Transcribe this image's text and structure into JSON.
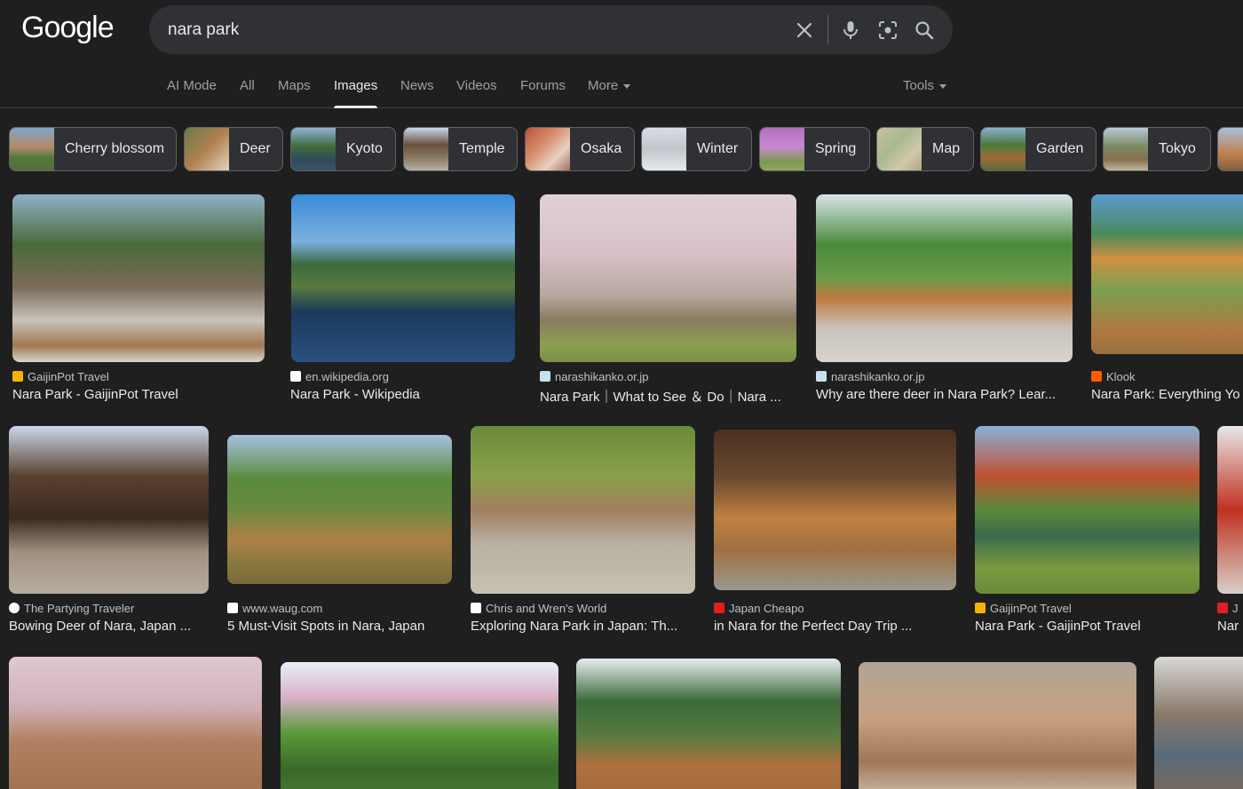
{
  "logo": "Google",
  "search": {
    "query": "nara park"
  },
  "tabs": [
    "AI Mode",
    "All",
    "Maps",
    "Images",
    "News",
    "Videos",
    "Forums",
    "More"
  ],
  "active_tab": "Images",
  "tools_label": "Tools",
  "chips": [
    "Cherry blossom",
    "Deer",
    "Kyoto",
    "Temple",
    "Osaka",
    "Winter",
    "Spring",
    "Map",
    "Garden",
    "Tokyo"
  ],
  "results_row1": [
    {
      "source": "GaijinPot Travel",
      "title": "Nara Park - GaijinPot Travel"
    },
    {
      "source": "en.wikipedia.org",
      "title": "Nara Park - Wikipedia"
    },
    {
      "source": "narashikanko.or.jp",
      "title": "Nara Park｜What to See ＆ Do｜Nara ..."
    },
    {
      "source": "narashikanko.or.jp",
      "title": "Why are there deer in Nara Park? Lear..."
    },
    {
      "source": "Klook",
      "title": "Nara Park: Everything Yo"
    }
  ],
  "results_row2": [
    {
      "source": "The Partying Traveler",
      "title": "Bowing Deer of Nara, Japan ..."
    },
    {
      "source": "www.waug.com",
      "title": "5 Must-Visit Spots in Nara, Japan"
    },
    {
      "source": "Chris and Wren's World",
      "title": "Exploring Nara Park in Japan: Th..."
    },
    {
      "source": "Japan Cheapo",
      "title": "in Nara for the Perfect Day Trip ..."
    },
    {
      "source": "GaijinPot Travel",
      "title": "Nara Park - GaijinPot Travel"
    },
    {
      "source": "J",
      "title": "Nar"
    }
  ],
  "colors": {
    "background": "#1f1f1f",
    "searchbox": "#303134",
    "text": "#e8eaed",
    "muted": "#9aa0a6"
  },
  "icons": [
    "clear-icon",
    "microphone-icon",
    "camera-lens-icon",
    "search-icon"
  ]
}
